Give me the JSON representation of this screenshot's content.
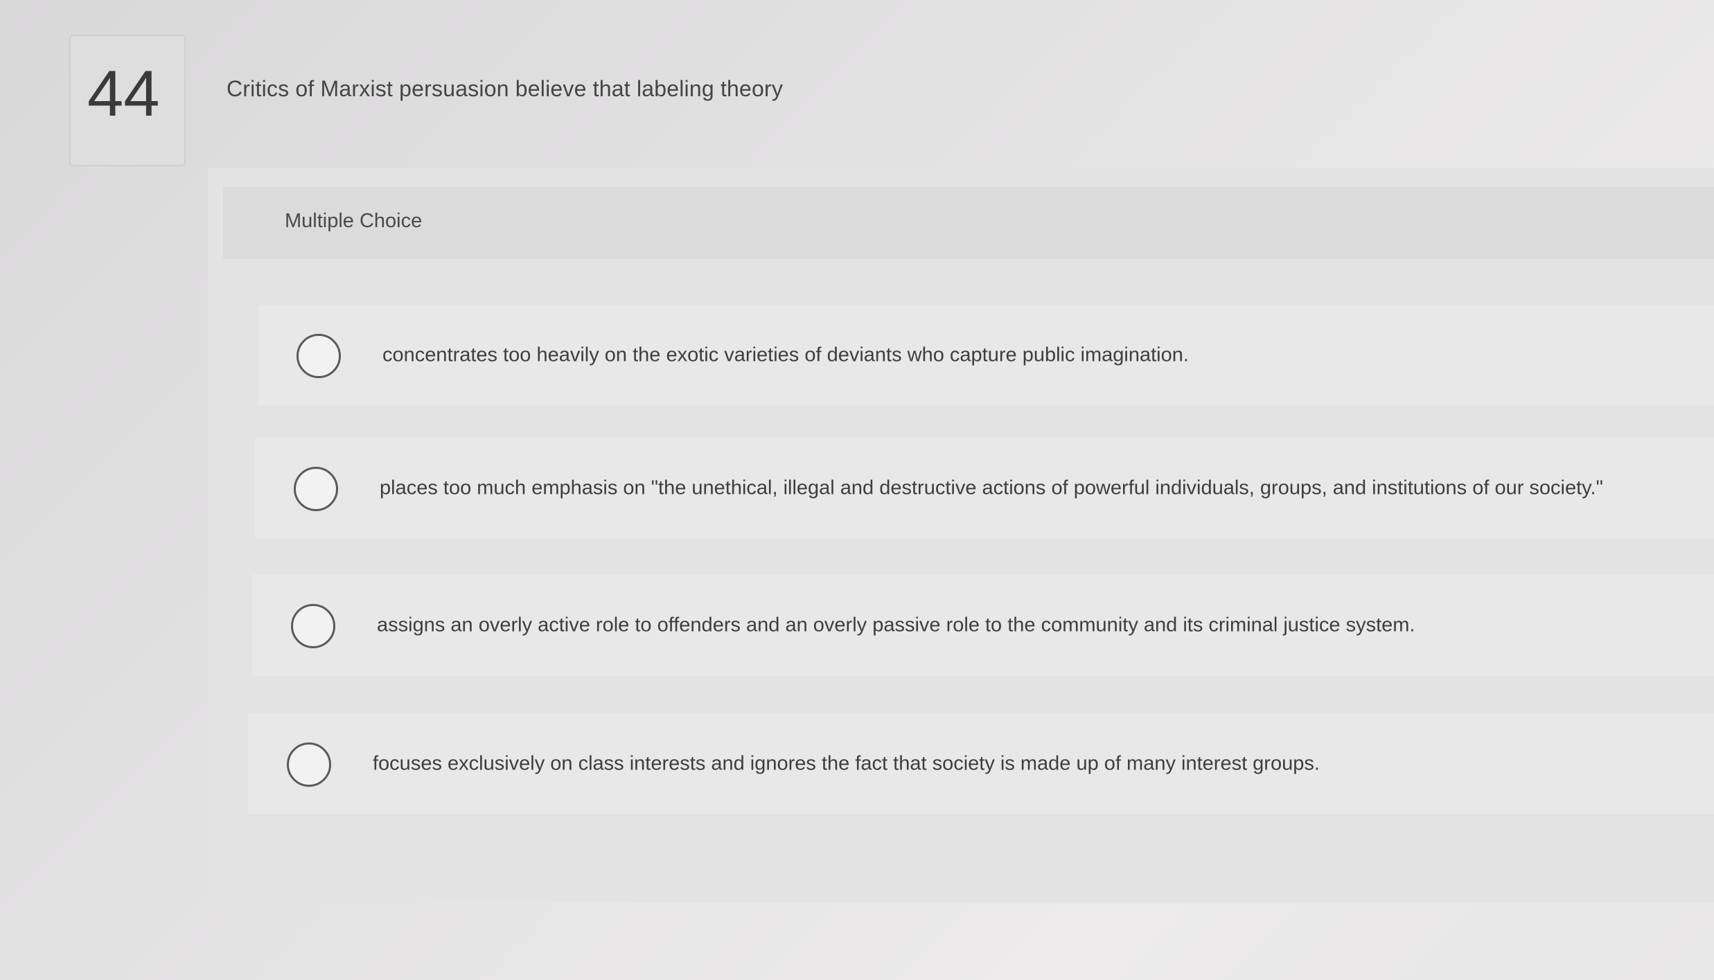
{
  "question": {
    "number": "44",
    "prompt": "Critics of Marxist persuasion believe that labeling theory",
    "type_label": "Multiple Choice",
    "options": [
      {
        "text": "concentrates too heavily on the exotic varieties of deviants who capture public imagination."
      },
      {
        "text": "places too much emphasis on \"the unethical, illegal and destructive actions of powerful individuals, groups, and institutions of our society.\""
      },
      {
        "text": "assigns an overly active role to offenders and an overly passive role to the community and its criminal justice system."
      },
      {
        "text": "focuses exclusively on class interests and ignores the fact that society is made up of many interest groups."
      }
    ]
  }
}
